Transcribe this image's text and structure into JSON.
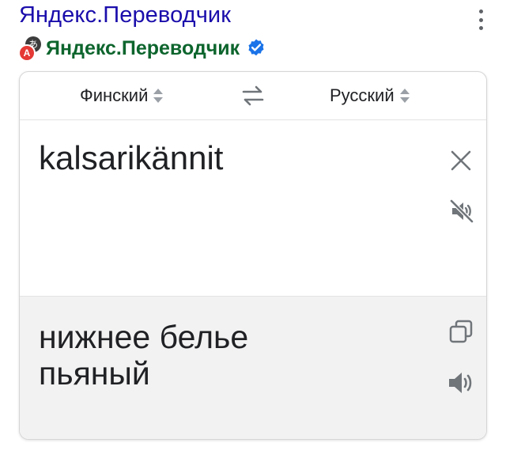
{
  "header": {
    "title": "Яндекс.Переводчик",
    "source_name": "Яндекс.Переводчик",
    "favicon_back_glyph": "あ",
    "favicon_front_glyph": "A",
    "icons": [
      "more-vert-icon",
      "verified-check-icon"
    ],
    "colors": {
      "title": "#1a0dab",
      "source": "#0d652d",
      "verified": "#1a73e8"
    }
  },
  "translator": {
    "source_lang": "Финский",
    "target_lang": "Русский",
    "source_text": "kalsarikännit",
    "result_lines": [
      "нижнее белье",
      "пьяный"
    ],
    "icons": [
      "updown-icon",
      "swap-icon",
      "close-icon",
      "mute-icon",
      "copy-icon",
      "volume-icon"
    ]
  }
}
